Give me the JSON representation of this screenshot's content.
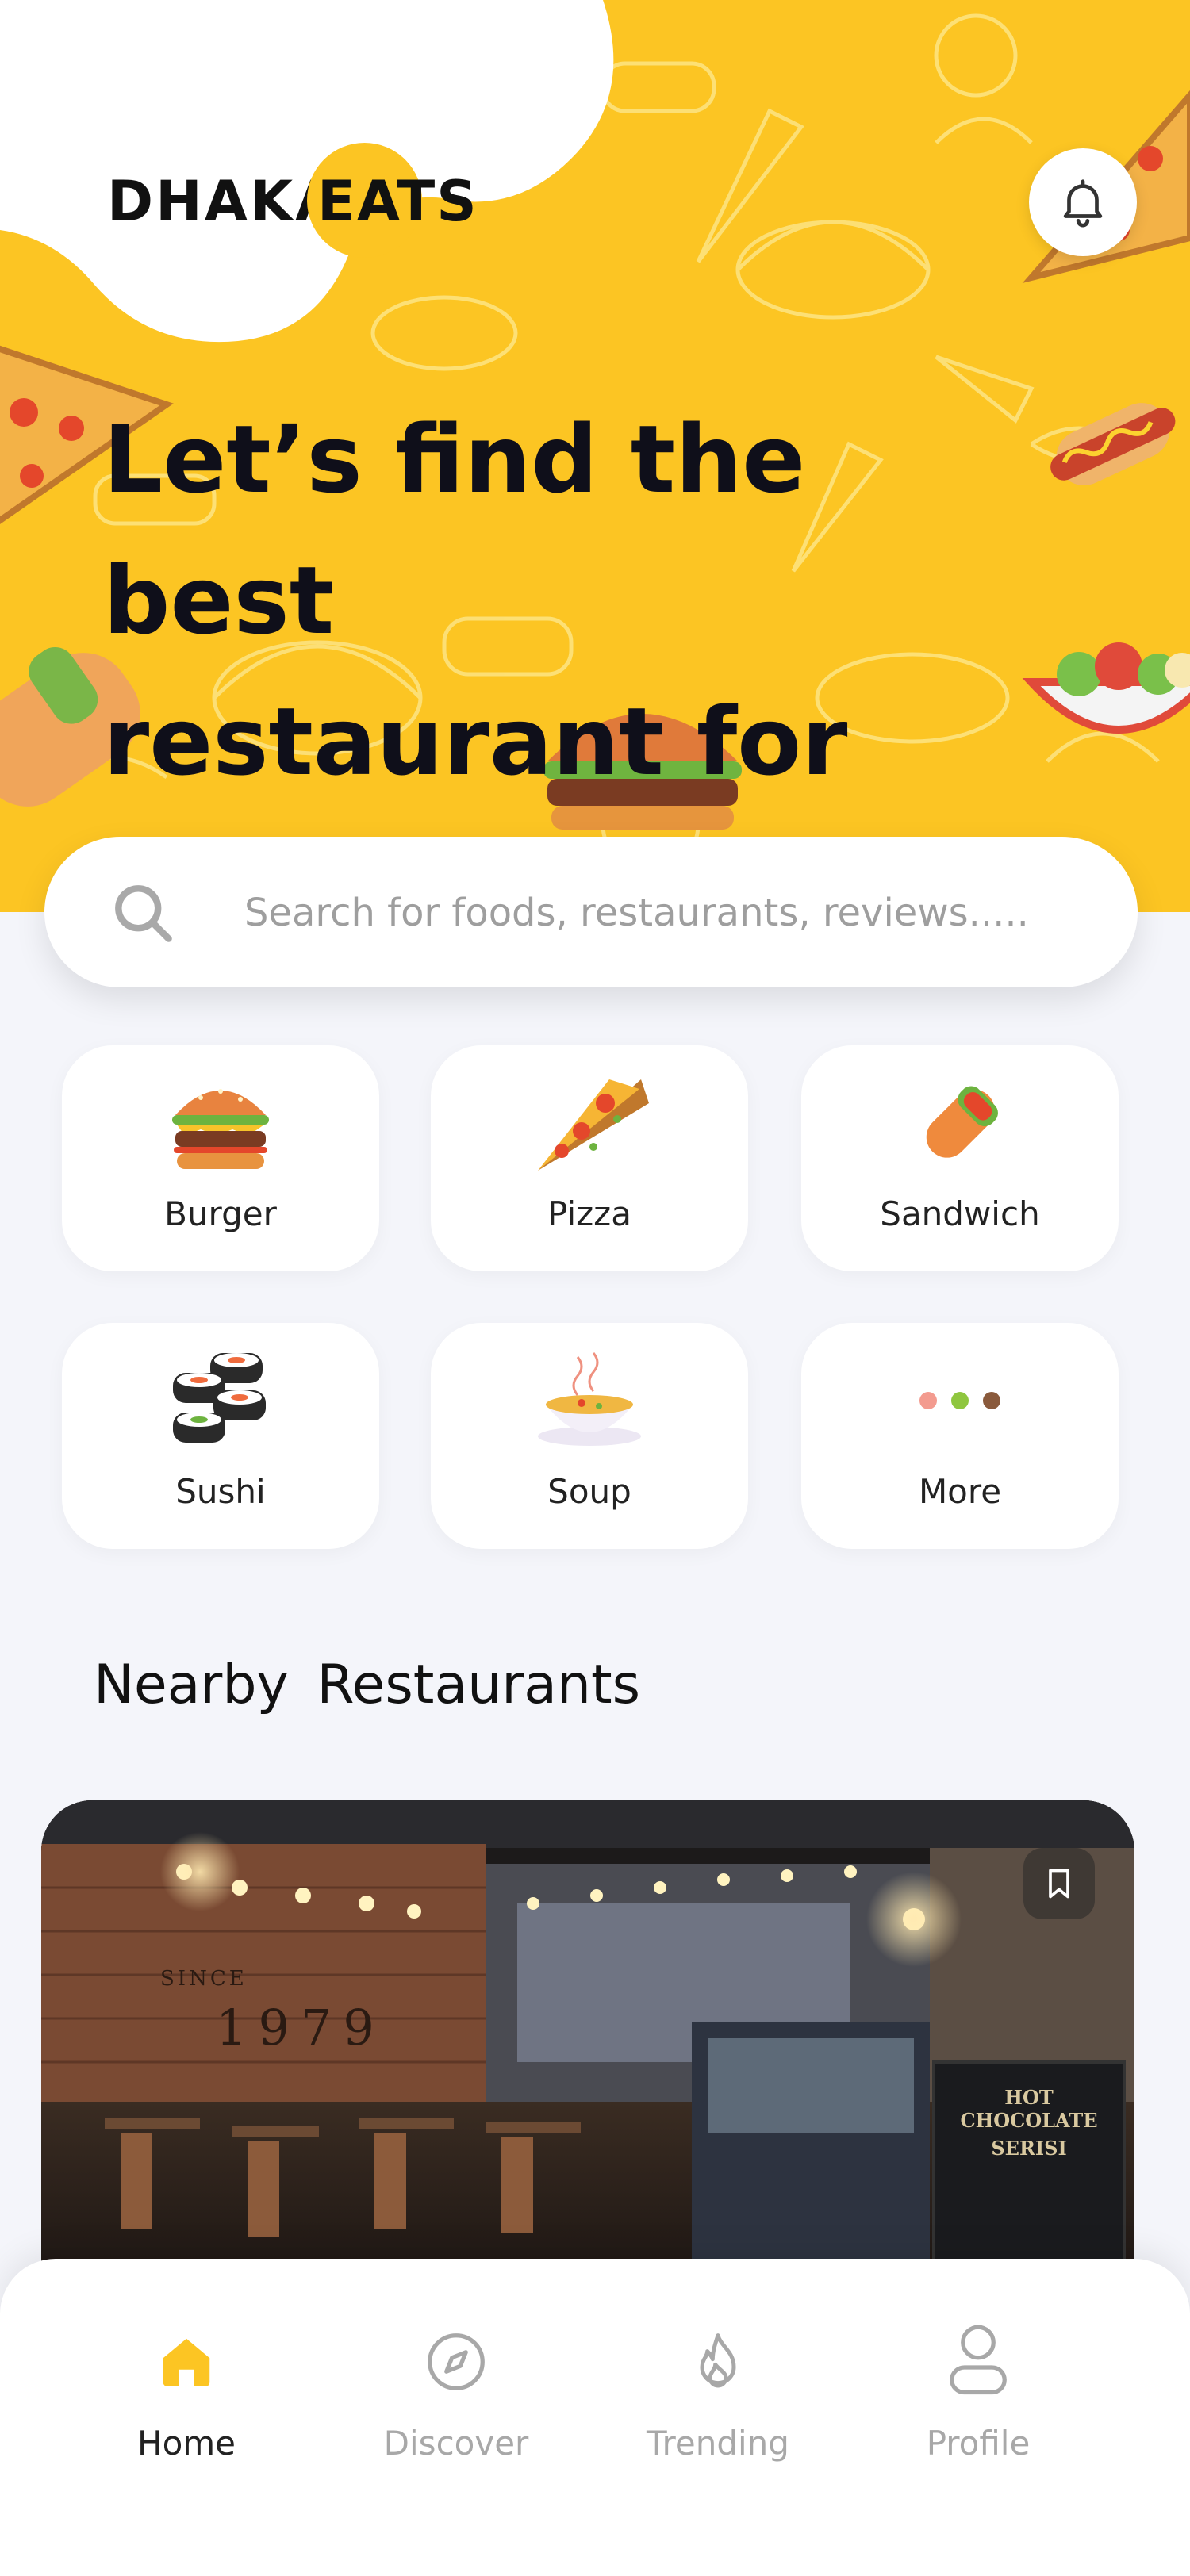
{
  "app": {
    "brand_part1": "DHAKA",
    "brand_part2": "EATS"
  },
  "colors": {
    "accent": "#fcc523",
    "background": "#f4f5fa",
    "text": "#111111",
    "muted": "#a8a8a8"
  },
  "header": {
    "notification_icon": "bell-icon"
  },
  "hero": {
    "line1": "Let’s find the best",
    "line2": "restaurant for you"
  },
  "search": {
    "placeholder": "Search for foods, restaurants, reviews.....",
    "icon": "search-icon"
  },
  "categories": [
    {
      "label": "Burger",
      "icon": "burger-icon"
    },
    {
      "label": "Pizza",
      "icon": "pizza-icon"
    },
    {
      "label": "Sandwich",
      "icon": "sandwich-icon"
    },
    {
      "label": "Sushi",
      "icon": "sushi-icon"
    },
    {
      "label": "Soup",
      "icon": "soup-icon"
    },
    {
      "label": "More",
      "icon": "more-dots-icon"
    }
  ],
  "nearby": {
    "title": "Nearby  Restaurants",
    "card": {
      "wall_text_1": "SINCE",
      "wall_text_2": "1979",
      "board_line_1": "HOT CHOCOLATE",
      "board_line_2": "SERISI",
      "bookmark_icon": "bookmark-icon"
    }
  },
  "nav": {
    "items": [
      {
        "label": "Home",
        "icon": "home-icon",
        "active": true
      },
      {
        "label": "Discover",
        "icon": "compass-icon",
        "active": false
      },
      {
        "label": "Trending",
        "icon": "flame-icon",
        "active": false
      },
      {
        "label": "Profile",
        "icon": "user-icon",
        "active": false
      }
    ]
  }
}
